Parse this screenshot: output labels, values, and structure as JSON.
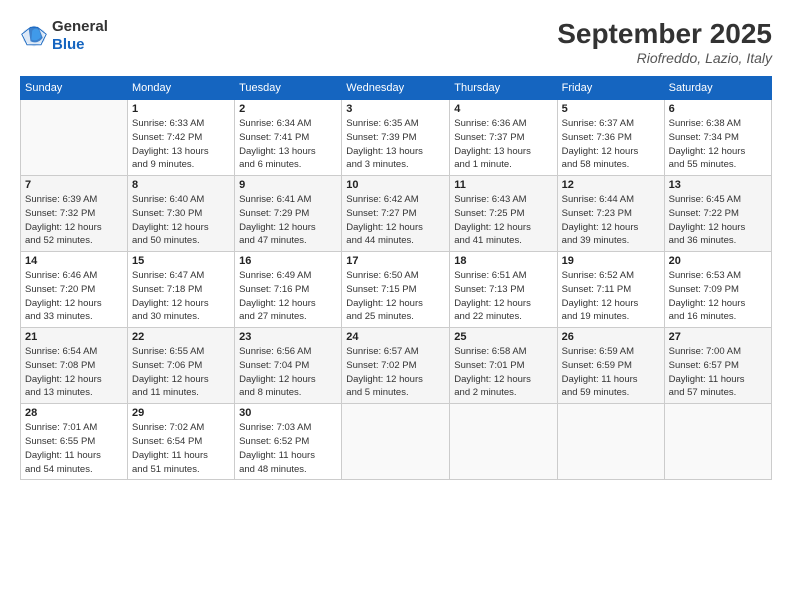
{
  "header": {
    "logo_line1": "General",
    "logo_line2": "Blue",
    "month": "September 2025",
    "location": "Riofreddo, Lazio, Italy"
  },
  "weekdays": [
    "Sunday",
    "Monday",
    "Tuesday",
    "Wednesday",
    "Thursday",
    "Friday",
    "Saturday"
  ],
  "weeks": [
    [
      {
        "day": "",
        "info": ""
      },
      {
        "day": "1",
        "info": "Sunrise: 6:33 AM\nSunset: 7:42 PM\nDaylight: 13 hours\nand 9 minutes."
      },
      {
        "day": "2",
        "info": "Sunrise: 6:34 AM\nSunset: 7:41 PM\nDaylight: 13 hours\nand 6 minutes."
      },
      {
        "day": "3",
        "info": "Sunrise: 6:35 AM\nSunset: 7:39 PM\nDaylight: 13 hours\nand 3 minutes."
      },
      {
        "day": "4",
        "info": "Sunrise: 6:36 AM\nSunset: 7:37 PM\nDaylight: 13 hours\nand 1 minute."
      },
      {
        "day": "5",
        "info": "Sunrise: 6:37 AM\nSunset: 7:36 PM\nDaylight: 12 hours\nand 58 minutes."
      },
      {
        "day": "6",
        "info": "Sunrise: 6:38 AM\nSunset: 7:34 PM\nDaylight: 12 hours\nand 55 minutes."
      }
    ],
    [
      {
        "day": "7",
        "info": "Sunrise: 6:39 AM\nSunset: 7:32 PM\nDaylight: 12 hours\nand 52 minutes."
      },
      {
        "day": "8",
        "info": "Sunrise: 6:40 AM\nSunset: 7:30 PM\nDaylight: 12 hours\nand 50 minutes."
      },
      {
        "day": "9",
        "info": "Sunrise: 6:41 AM\nSunset: 7:29 PM\nDaylight: 12 hours\nand 47 minutes."
      },
      {
        "day": "10",
        "info": "Sunrise: 6:42 AM\nSunset: 7:27 PM\nDaylight: 12 hours\nand 44 minutes."
      },
      {
        "day": "11",
        "info": "Sunrise: 6:43 AM\nSunset: 7:25 PM\nDaylight: 12 hours\nand 41 minutes."
      },
      {
        "day": "12",
        "info": "Sunrise: 6:44 AM\nSunset: 7:23 PM\nDaylight: 12 hours\nand 39 minutes."
      },
      {
        "day": "13",
        "info": "Sunrise: 6:45 AM\nSunset: 7:22 PM\nDaylight: 12 hours\nand 36 minutes."
      }
    ],
    [
      {
        "day": "14",
        "info": "Sunrise: 6:46 AM\nSunset: 7:20 PM\nDaylight: 12 hours\nand 33 minutes."
      },
      {
        "day": "15",
        "info": "Sunrise: 6:47 AM\nSunset: 7:18 PM\nDaylight: 12 hours\nand 30 minutes."
      },
      {
        "day": "16",
        "info": "Sunrise: 6:49 AM\nSunset: 7:16 PM\nDaylight: 12 hours\nand 27 minutes."
      },
      {
        "day": "17",
        "info": "Sunrise: 6:50 AM\nSunset: 7:15 PM\nDaylight: 12 hours\nand 25 minutes."
      },
      {
        "day": "18",
        "info": "Sunrise: 6:51 AM\nSunset: 7:13 PM\nDaylight: 12 hours\nand 22 minutes."
      },
      {
        "day": "19",
        "info": "Sunrise: 6:52 AM\nSunset: 7:11 PM\nDaylight: 12 hours\nand 19 minutes."
      },
      {
        "day": "20",
        "info": "Sunrise: 6:53 AM\nSunset: 7:09 PM\nDaylight: 12 hours\nand 16 minutes."
      }
    ],
    [
      {
        "day": "21",
        "info": "Sunrise: 6:54 AM\nSunset: 7:08 PM\nDaylight: 12 hours\nand 13 minutes."
      },
      {
        "day": "22",
        "info": "Sunrise: 6:55 AM\nSunset: 7:06 PM\nDaylight: 12 hours\nand 11 minutes."
      },
      {
        "day": "23",
        "info": "Sunrise: 6:56 AM\nSunset: 7:04 PM\nDaylight: 12 hours\nand 8 minutes."
      },
      {
        "day": "24",
        "info": "Sunrise: 6:57 AM\nSunset: 7:02 PM\nDaylight: 12 hours\nand 5 minutes."
      },
      {
        "day": "25",
        "info": "Sunrise: 6:58 AM\nSunset: 7:01 PM\nDaylight: 12 hours\nand 2 minutes."
      },
      {
        "day": "26",
        "info": "Sunrise: 6:59 AM\nSunset: 6:59 PM\nDaylight: 11 hours\nand 59 minutes."
      },
      {
        "day": "27",
        "info": "Sunrise: 7:00 AM\nSunset: 6:57 PM\nDaylight: 11 hours\nand 57 minutes."
      }
    ],
    [
      {
        "day": "28",
        "info": "Sunrise: 7:01 AM\nSunset: 6:55 PM\nDaylight: 11 hours\nand 54 minutes."
      },
      {
        "day": "29",
        "info": "Sunrise: 7:02 AM\nSunset: 6:54 PM\nDaylight: 11 hours\nand 51 minutes."
      },
      {
        "day": "30",
        "info": "Sunrise: 7:03 AM\nSunset: 6:52 PM\nDaylight: 11 hours\nand 48 minutes."
      },
      {
        "day": "",
        "info": ""
      },
      {
        "day": "",
        "info": ""
      },
      {
        "day": "",
        "info": ""
      },
      {
        "day": "",
        "info": ""
      }
    ]
  ]
}
